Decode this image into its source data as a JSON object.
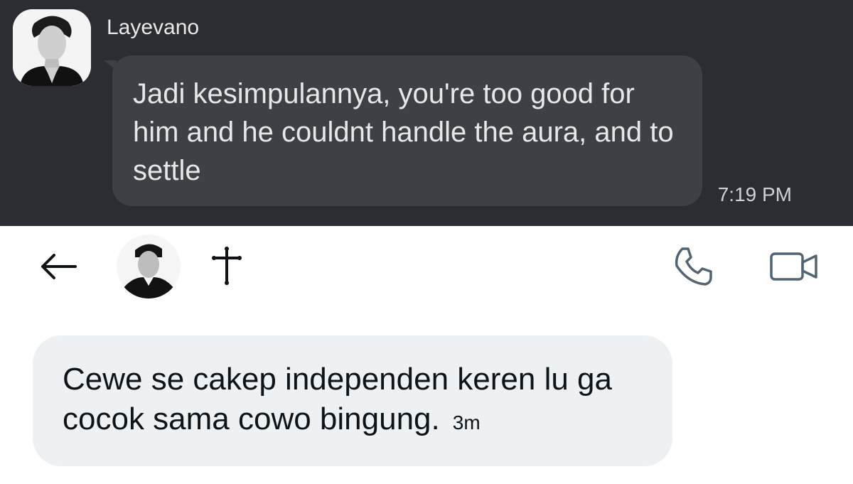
{
  "top_chat": {
    "sender": "Layevano",
    "message": "Jadi kesimpulannya, you're too good for him and he couldnt handle the aura, and to settle",
    "time": "7:19 PM"
  },
  "header": {
    "back_icon": "arrow-left-icon",
    "name_glyph": "✝",
    "call_icon": "phone-icon",
    "video_icon": "video-camera-icon"
  },
  "bottom_chat": {
    "message": "Cewe se cakep independen keren lu ga cocok sama cowo bingung.",
    "time": "3m"
  },
  "colors": {
    "top_bg": "#2b2d33",
    "top_bubble": "#3e4045",
    "bottom_bubble": "#edf1f3",
    "text_dark": "#0f1419",
    "icon_gray": "#536471"
  }
}
